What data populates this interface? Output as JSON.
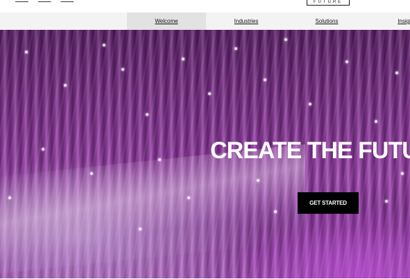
{
  "top_links": [
    "— — —",
    "— — —",
    "— — —"
  ],
  "logo_text": "FUTURE",
  "nav": {
    "items": [
      {
        "label": "Welcome",
        "active": true
      },
      {
        "label": "Industries",
        "active": false
      },
      {
        "label": "Solutions",
        "active": false
      },
      {
        "label": "Insights",
        "active": false
      }
    ]
  },
  "hero": {
    "title": "CREATE THE FUTURE",
    "cta_label": "GET STARTED"
  },
  "colors": {
    "nav_bg": "#f3f3f3",
    "nav_active_bg": "#e2e2e2",
    "cta_bg": "#000000",
    "hero_purple": "#8f3aa0"
  }
}
